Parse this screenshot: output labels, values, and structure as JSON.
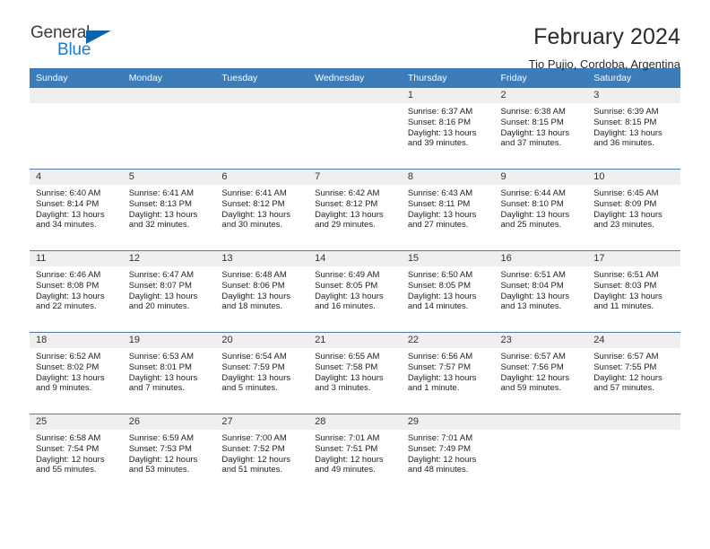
{
  "logo": {
    "text_primary": "General",
    "text_secondary": "Blue",
    "primary_color": "#3b3b3b",
    "secondary_color": "#1c7cc7",
    "triangle_color": "#0a63ad"
  },
  "header": {
    "title": "February 2024",
    "subtitle": "Tio Pujio, Cordoba, Argentina",
    "header_bg": "#3b7cb9",
    "daynum_bg": "#efefef"
  },
  "weekday_headers": [
    "Sunday",
    "Monday",
    "Tuesday",
    "Wednesday",
    "Thursday",
    "Friday",
    "Saturday"
  ],
  "weeks": [
    [
      {
        "day": "",
        "sunrise": "",
        "sunset": "",
        "daylight_line1": "",
        "daylight_line2": ""
      },
      {
        "day": "",
        "sunrise": "",
        "sunset": "",
        "daylight_line1": "",
        "daylight_line2": ""
      },
      {
        "day": "",
        "sunrise": "",
        "sunset": "",
        "daylight_line1": "",
        "daylight_line2": ""
      },
      {
        "day": "",
        "sunrise": "",
        "sunset": "",
        "daylight_line1": "",
        "daylight_line2": ""
      },
      {
        "day": "1",
        "sunrise": "Sunrise: 6:37 AM",
        "sunset": "Sunset: 8:16 PM",
        "daylight_line1": "Daylight: 13 hours",
        "daylight_line2": "and 39 minutes."
      },
      {
        "day": "2",
        "sunrise": "Sunrise: 6:38 AM",
        "sunset": "Sunset: 8:15 PM",
        "daylight_line1": "Daylight: 13 hours",
        "daylight_line2": "and 37 minutes."
      },
      {
        "day": "3",
        "sunrise": "Sunrise: 6:39 AM",
        "sunset": "Sunset: 8:15 PM",
        "daylight_line1": "Daylight: 13 hours",
        "daylight_line2": "and 36 minutes."
      }
    ],
    [
      {
        "day": "4",
        "sunrise": "Sunrise: 6:40 AM",
        "sunset": "Sunset: 8:14 PM",
        "daylight_line1": "Daylight: 13 hours",
        "daylight_line2": "and 34 minutes."
      },
      {
        "day": "5",
        "sunrise": "Sunrise: 6:41 AM",
        "sunset": "Sunset: 8:13 PM",
        "daylight_line1": "Daylight: 13 hours",
        "daylight_line2": "and 32 minutes."
      },
      {
        "day": "6",
        "sunrise": "Sunrise: 6:41 AM",
        "sunset": "Sunset: 8:12 PM",
        "daylight_line1": "Daylight: 13 hours",
        "daylight_line2": "and 30 minutes."
      },
      {
        "day": "7",
        "sunrise": "Sunrise: 6:42 AM",
        "sunset": "Sunset: 8:12 PM",
        "daylight_line1": "Daylight: 13 hours",
        "daylight_line2": "and 29 minutes."
      },
      {
        "day": "8",
        "sunrise": "Sunrise: 6:43 AM",
        "sunset": "Sunset: 8:11 PM",
        "daylight_line1": "Daylight: 13 hours",
        "daylight_line2": "and 27 minutes."
      },
      {
        "day": "9",
        "sunrise": "Sunrise: 6:44 AM",
        "sunset": "Sunset: 8:10 PM",
        "daylight_line1": "Daylight: 13 hours",
        "daylight_line2": "and 25 minutes."
      },
      {
        "day": "10",
        "sunrise": "Sunrise: 6:45 AM",
        "sunset": "Sunset: 8:09 PM",
        "daylight_line1": "Daylight: 13 hours",
        "daylight_line2": "and 23 minutes."
      }
    ],
    [
      {
        "day": "11",
        "sunrise": "Sunrise: 6:46 AM",
        "sunset": "Sunset: 8:08 PM",
        "daylight_line1": "Daylight: 13 hours",
        "daylight_line2": "and 22 minutes."
      },
      {
        "day": "12",
        "sunrise": "Sunrise: 6:47 AM",
        "sunset": "Sunset: 8:07 PM",
        "daylight_line1": "Daylight: 13 hours",
        "daylight_line2": "and 20 minutes."
      },
      {
        "day": "13",
        "sunrise": "Sunrise: 6:48 AM",
        "sunset": "Sunset: 8:06 PM",
        "daylight_line1": "Daylight: 13 hours",
        "daylight_line2": "and 18 minutes."
      },
      {
        "day": "14",
        "sunrise": "Sunrise: 6:49 AM",
        "sunset": "Sunset: 8:05 PM",
        "daylight_line1": "Daylight: 13 hours",
        "daylight_line2": "and 16 minutes."
      },
      {
        "day": "15",
        "sunrise": "Sunrise: 6:50 AM",
        "sunset": "Sunset: 8:05 PM",
        "daylight_line1": "Daylight: 13 hours",
        "daylight_line2": "and 14 minutes."
      },
      {
        "day": "16",
        "sunrise": "Sunrise: 6:51 AM",
        "sunset": "Sunset: 8:04 PM",
        "daylight_line1": "Daylight: 13 hours",
        "daylight_line2": "and 13 minutes."
      },
      {
        "day": "17",
        "sunrise": "Sunrise: 6:51 AM",
        "sunset": "Sunset: 8:03 PM",
        "daylight_line1": "Daylight: 13 hours",
        "daylight_line2": "and 11 minutes."
      }
    ],
    [
      {
        "day": "18",
        "sunrise": "Sunrise: 6:52 AM",
        "sunset": "Sunset: 8:02 PM",
        "daylight_line1": "Daylight: 13 hours",
        "daylight_line2": "and 9 minutes."
      },
      {
        "day": "19",
        "sunrise": "Sunrise: 6:53 AM",
        "sunset": "Sunset: 8:01 PM",
        "daylight_line1": "Daylight: 13 hours",
        "daylight_line2": "and 7 minutes."
      },
      {
        "day": "20",
        "sunrise": "Sunrise: 6:54 AM",
        "sunset": "Sunset: 7:59 PM",
        "daylight_line1": "Daylight: 13 hours",
        "daylight_line2": "and 5 minutes."
      },
      {
        "day": "21",
        "sunrise": "Sunrise: 6:55 AM",
        "sunset": "Sunset: 7:58 PM",
        "daylight_line1": "Daylight: 13 hours",
        "daylight_line2": "and 3 minutes."
      },
      {
        "day": "22",
        "sunrise": "Sunrise: 6:56 AM",
        "sunset": "Sunset: 7:57 PM",
        "daylight_line1": "Daylight: 13 hours",
        "daylight_line2": "and 1 minute."
      },
      {
        "day": "23",
        "sunrise": "Sunrise: 6:57 AM",
        "sunset": "Sunset: 7:56 PM",
        "daylight_line1": "Daylight: 12 hours",
        "daylight_line2": "and 59 minutes."
      },
      {
        "day": "24",
        "sunrise": "Sunrise: 6:57 AM",
        "sunset": "Sunset: 7:55 PM",
        "daylight_line1": "Daylight: 12 hours",
        "daylight_line2": "and 57 minutes."
      }
    ],
    [
      {
        "day": "25",
        "sunrise": "Sunrise: 6:58 AM",
        "sunset": "Sunset: 7:54 PM",
        "daylight_line1": "Daylight: 12 hours",
        "daylight_line2": "and 55 minutes."
      },
      {
        "day": "26",
        "sunrise": "Sunrise: 6:59 AM",
        "sunset": "Sunset: 7:53 PM",
        "daylight_line1": "Daylight: 12 hours",
        "daylight_line2": "and 53 minutes."
      },
      {
        "day": "27",
        "sunrise": "Sunrise: 7:00 AM",
        "sunset": "Sunset: 7:52 PM",
        "daylight_line1": "Daylight: 12 hours",
        "daylight_line2": "and 51 minutes."
      },
      {
        "day": "28",
        "sunrise": "Sunrise: 7:01 AM",
        "sunset": "Sunset: 7:51 PM",
        "daylight_line1": "Daylight: 12 hours",
        "daylight_line2": "and 49 minutes."
      },
      {
        "day": "29",
        "sunrise": "Sunrise: 7:01 AM",
        "sunset": "Sunset: 7:49 PM",
        "daylight_line1": "Daylight: 12 hours",
        "daylight_line2": "and 48 minutes."
      },
      {
        "day": "",
        "sunrise": "",
        "sunset": "",
        "daylight_line1": "",
        "daylight_line2": ""
      },
      {
        "day": "",
        "sunrise": "",
        "sunset": "",
        "daylight_line1": "",
        "daylight_line2": ""
      }
    ]
  ]
}
